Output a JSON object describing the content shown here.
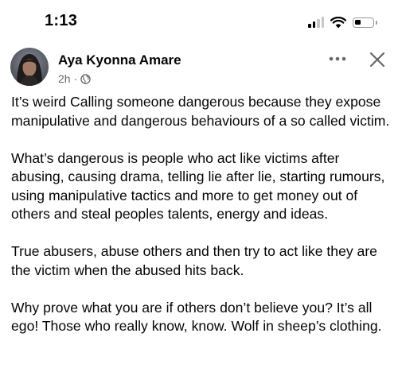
{
  "status_bar": {
    "time": "1:13"
  },
  "post": {
    "author": "Aya Kyonna Amare",
    "timestamp": "2h",
    "separator": "·",
    "privacy_icon": "globe-icon",
    "paragraphs": [
      "It’s weird Calling someone dangerous because they expose  manipulative and dangerous behaviours of a so called victim.",
      "What’s dangerous is people who act like victims after abusing, causing drama, telling lie after lie, starting rumours, using manipulative tactics and more to get money out of others and steal peoples talents, energy and ideas.",
      "True abusers, abuse others and then try to act like they are the victim when the abused hits back.",
      "Why prove what you are if others don’t believe you? It’s all ego! Those who really know, know. Wolf in sheep’s clothing."
    ]
  },
  "icons": {
    "more": "more-horizontal-icon",
    "close": "close-icon"
  },
  "colors": {
    "text": "#050505",
    "secondary_text": "#65676b",
    "background": "#ffffff"
  }
}
